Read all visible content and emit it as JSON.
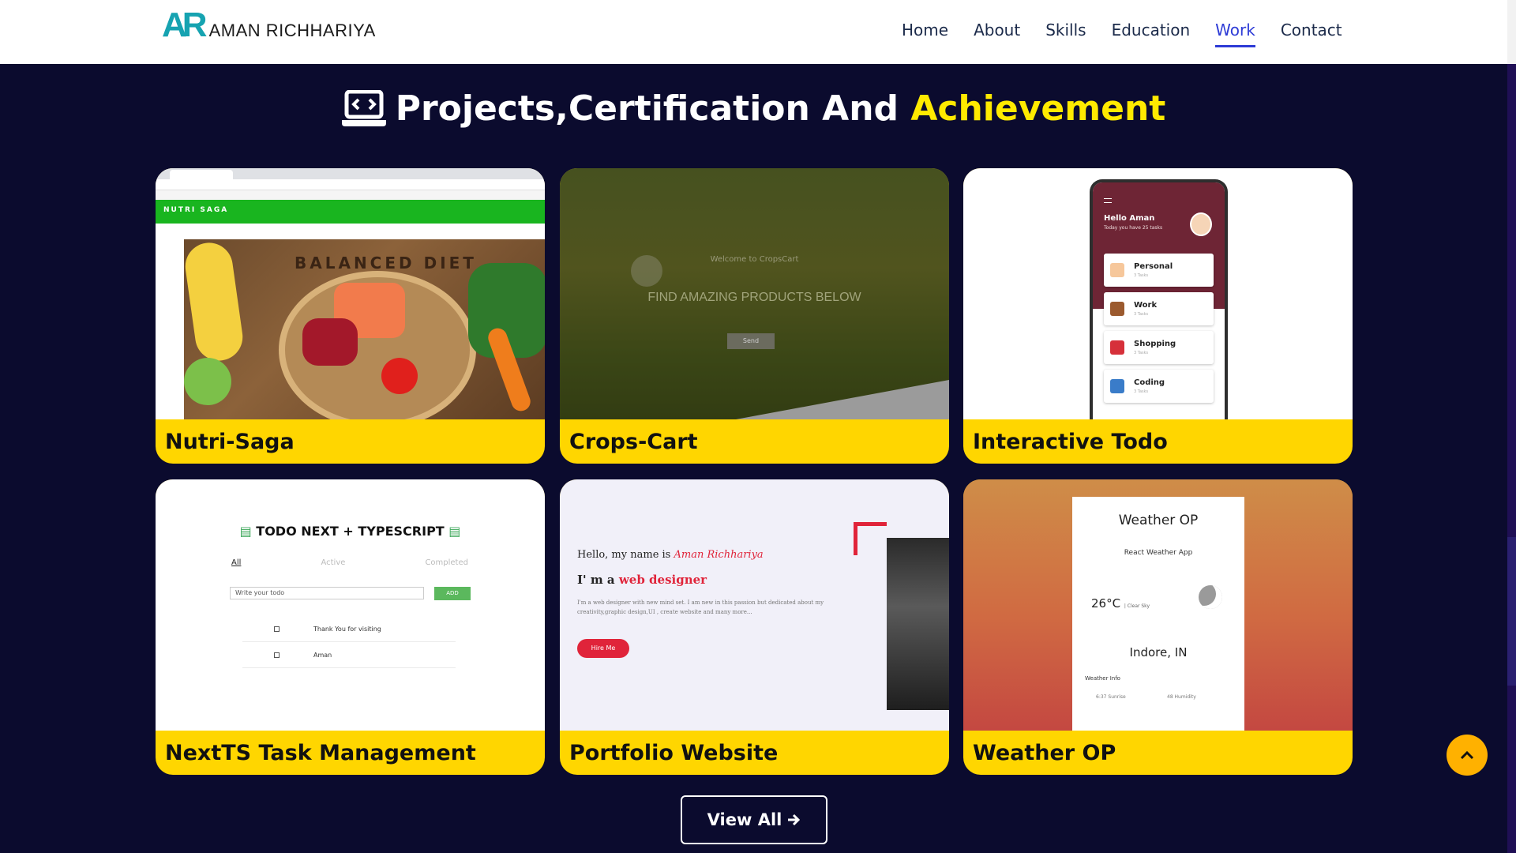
{
  "header": {
    "logo_mark": "AR",
    "logo_text": "AMAN RICHHARIYA",
    "nav": [
      {
        "label": "Home"
      },
      {
        "label": "About"
      },
      {
        "label": "Skills"
      },
      {
        "label": "Education"
      },
      {
        "label": "Work"
      },
      {
        "label": "Contact"
      }
    ],
    "active_nav": "Work"
  },
  "section": {
    "title_prefix": "Projects,Certification And",
    "title_accent": "Achievement",
    "title_icon": "laptop-code-icon",
    "accent_color": "#ffea00"
  },
  "projects": [
    {
      "label": "Nutri-Saga",
      "preview": {
        "site_title": "NUTRI SAGA",
        "photo_text": "BALANCED DIET"
      }
    },
    {
      "label": "Crops-Cart",
      "preview": {
        "welcome": "Welcome to CropsCart",
        "headline": "FIND AMAZING PRODUCTS BELOW",
        "button": "Send"
      }
    },
    {
      "label": "Interactive Todo",
      "preview": {
        "greeting": "Hello Aman",
        "subtitle": "Today you have 25 tasks",
        "categories": [
          {
            "name": "Personal",
            "count": "3 Tasks"
          },
          {
            "name": "Work",
            "count": "3 Tasks"
          },
          {
            "name": "Shopping",
            "count": "3 Tasks"
          },
          {
            "name": "Coding",
            "count": "3 Tasks"
          }
        ]
      }
    },
    {
      "label": "NextTS Task Management",
      "preview": {
        "title": "TODO NEXT + TYPESCRIPT",
        "tabs": [
          "All",
          "Active",
          "Completed"
        ],
        "input_placeholder": "Write your todo",
        "add_button": "ADD",
        "todos": [
          "Thank You for visiting",
          "Aman"
        ]
      }
    },
    {
      "label": "Portfolio Website",
      "preview": {
        "hello": "Hello, my name is",
        "name": "Aman Richhariya",
        "iam": "I' m a",
        "role": "web designer",
        "desc": "I'm a web designer with new mind set. I am new in this passion but dedicated about my creativity,graphic design,UI , create website and many more...",
        "button": "Hire Me"
      }
    },
    {
      "label": "Weather OP",
      "preview": {
        "title": "Weather OP",
        "subtitle": "React Weather App",
        "temp": "26°C",
        "sky": "| Clear Sky",
        "city": "Indore, IN",
        "info_label": "Weather Info",
        "stats": [
          "6:37 Sunrise",
          "48 Humidity"
        ]
      }
    }
  ],
  "view_all": {
    "label": "View All"
  },
  "scroll_top": {
    "icon": "chevron-up-icon",
    "color": "#ffb100"
  }
}
